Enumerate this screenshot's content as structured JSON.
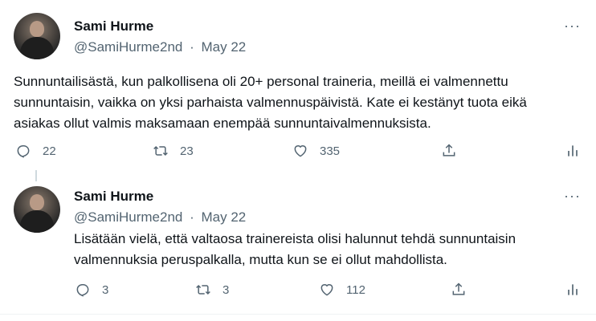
{
  "tweets": [
    {
      "author": "Sami Hurme",
      "handle": "@SamiHurme2nd",
      "separator": "·",
      "date": "May 22",
      "more": "···",
      "text": "Sunnuntailisästä, kun palkollisena oli 20+ personal traineria, meillä ei valmennettu sunnuntaisin, vaikka on yksi parhaista valmennuspäivistä. Kate ei kestänyt tuota eikä asiakas ollut valmis maksamaan enempää sunnuntaivalmennuksista.",
      "replies": "22",
      "retweets": "23",
      "likes": "335"
    },
    {
      "author": "Sami Hurme",
      "handle": "@SamiHurme2nd",
      "separator": "·",
      "date": "May 22",
      "more": "···",
      "text": "Lisätään vielä, että valtaosa trainereista olisi halunnut tehdä sunnuntaisin valmennuksia peruspalkalla, mutta kun se ei ollut mahdollista.",
      "replies": "3",
      "retweets": "3",
      "likes": "112"
    }
  ],
  "icons": {
    "reply": "reply-icon",
    "retweet": "retweet-icon",
    "like": "heart-icon",
    "share": "share-icon",
    "analytics": "analytics-icon"
  }
}
